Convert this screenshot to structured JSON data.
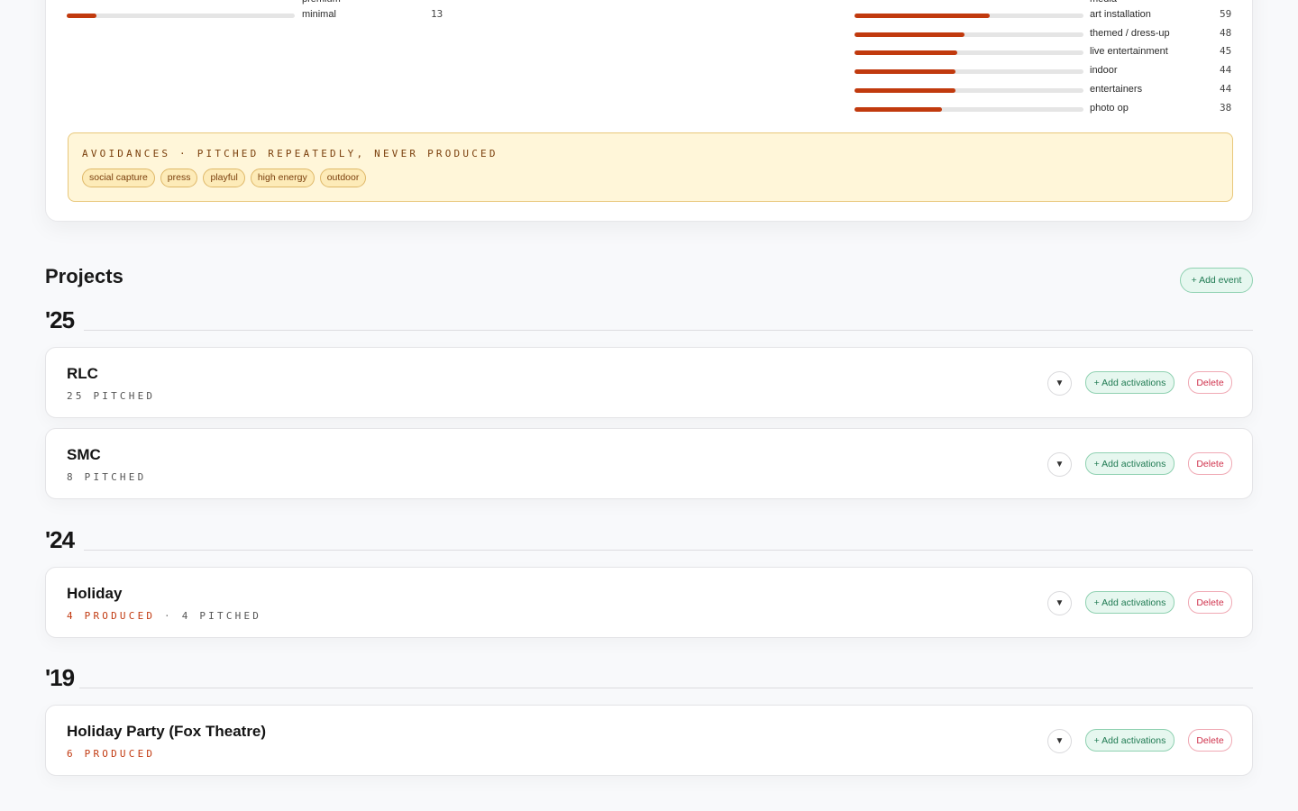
{
  "attributes": {
    "left": {
      "clipped_label": "premium",
      "rows": [
        {
          "label": "minimal",
          "count": 13,
          "fraction": 0.13
        }
      ]
    },
    "right": {
      "clipped_label": "media",
      "rows": [
        {
          "label": "art installation",
          "count": 59,
          "fraction": 0.59
        },
        {
          "label": "themed / dress-up",
          "count": 48,
          "fraction": 0.48
        },
        {
          "label": "live entertainment",
          "count": 45,
          "fraction": 0.45
        },
        {
          "label": "indoor",
          "count": 44,
          "fraction": 0.44
        },
        {
          "label": "entertainers",
          "count": 44,
          "fraction": 0.44
        },
        {
          "label": "photo op",
          "count": 38,
          "fraction": 0.38
        }
      ]
    }
  },
  "avoidances": {
    "title": "AVOIDANCES · PITCHED REPEATEDLY, NEVER PRODUCED",
    "chips": [
      "social capture",
      "press",
      "playful",
      "high energy",
      "outdoor"
    ]
  },
  "projects": {
    "title": "Projects",
    "add_event_label": "+ Add event",
    "chevron_glyph": "▼",
    "add_activations_label": "+ Add activations",
    "delete_label": "Delete",
    "meta_separator": "·",
    "groups": [
      {
        "year": "'25",
        "events": [
          {
            "name": "RLC",
            "produced": "",
            "pitched": "25 PITCHED"
          },
          {
            "name": "SMC",
            "produced": "",
            "pitched": "8 PITCHED"
          }
        ]
      },
      {
        "year": "'24",
        "events": [
          {
            "name": "Holiday",
            "produced": "4 PRODUCED",
            "pitched": "4 PITCHED"
          }
        ]
      },
      {
        "year": "'19",
        "events": [
          {
            "name": "Holiday Party (Fox Theatre)",
            "produced": "6 PRODUCED",
            "pitched": ""
          }
        ]
      }
    ]
  },
  "colors": {
    "bar_fill": "#c13a0e",
    "accent_green": "#1f7a52",
    "delete_red": "#d0334d",
    "produced_orange": "#c23b12"
  }
}
